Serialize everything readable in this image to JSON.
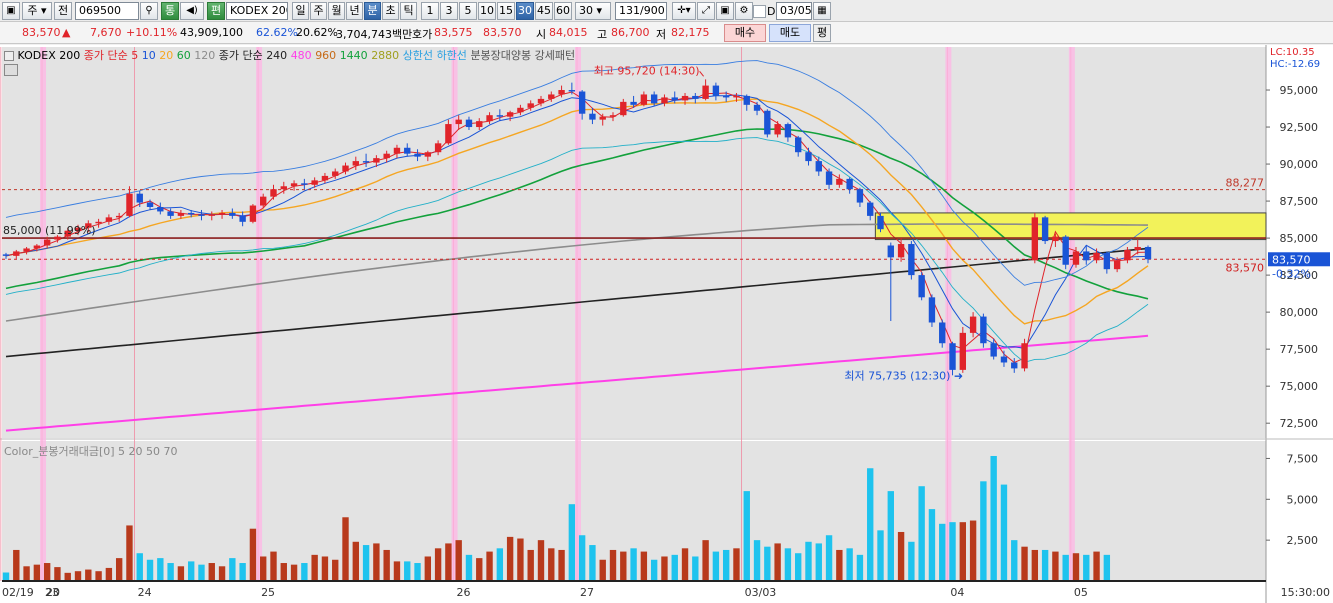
{
  "toolbar": {
    "period_type": "주",
    "prev_label": "전",
    "code": "069500",
    "stock_tab": "통",
    "edit_label": "편",
    "name": "KODEX 200",
    "periods": [
      "일",
      "주",
      "월",
      "년",
      "분",
      "초",
      "틱"
    ],
    "active_period": "분",
    "intervals": [
      "1",
      "3",
      "5",
      "10",
      "15",
      "30",
      "45",
      "60"
    ],
    "active_interval": "30",
    "interval_value": "30",
    "count_display": "131/900",
    "d_label": "D",
    "date": "03/05"
  },
  "quote": {
    "price": "83,570",
    "arrow": "▲",
    "change": "7,670",
    "change_pct": "+10.11%",
    "volume": "43,909,100",
    "ratio1": "62.62%",
    "ratio2": "20.62%",
    "amount": "3,704,743백만",
    "ask_label": "호가",
    "ask": "83,575",
    "bid": "83,570",
    "open_label": "시",
    "open": "84,015",
    "high_label": "고",
    "high": "86,700",
    "low_label": "저",
    "low": "82,175",
    "buy_label": "매수",
    "sell_label": "매도",
    "eval_label": "평"
  },
  "legend": {
    "name": "KODEX 200",
    "ma_label": "종가 단순",
    "ma1": "5",
    "ma2": "10",
    "ma3": "20",
    "ma4": "60",
    "ma5": "120",
    "ma_label2": "종가 단순",
    "ma6": "240",
    "ma7": "480",
    "ma8": "960",
    "ma9": "1440",
    "ma10": "2880",
    "upper": "상한선",
    "lower": "하한선",
    "pattern": "분봉장대양봉 강세패턴",
    "lc": "LC:10.35",
    "hc": "HC:-12.69"
  },
  "volume_legend": {
    "title": "Color_분봉거래대금[0]",
    "p1": "5",
    "p2": "20",
    "p3": "50",
    "p4": "70"
  },
  "annotations": {
    "high": "최고 95,720 (14:30)",
    "low": "최저 75,735 (12:30)",
    "level_85000": "85,000 (11.99%)",
    "line_88277": "88,277",
    "line_83570": "83,570",
    "price_tag": "83,570",
    "price_pct": "-0.32%"
  },
  "price_axis": [
    "95,000",
    "92,500",
    "90,000",
    "87,500",
    "85,000",
    "82,500",
    "80,000",
    "77,500",
    "75,000",
    "72,500"
  ],
  "volume_axis": [
    "7,500",
    "5,000",
    "2,500"
  ],
  "date_labels": [
    "02/19",
    "20",
    "23",
    "24",
    "25",
    "26",
    "27",
    "03/03",
    "04",
    "05"
  ],
  "time_label": "15:30:00",
  "colors": {
    "up": "#e0242a",
    "down": "#1a54d6",
    "ma5": "#e0242a",
    "ma10": "#1a54d6",
    "ma20": "#f5a623",
    "ma60": "#13a13c",
    "ma120": "#8c8c8c",
    "ma240": "#222222",
    "ma480": "#ff40e8",
    "vol_up": "#b83a1c",
    "vol_down": "#1ec3ee",
    "zone": "#f2f25a"
  },
  "chart_data": {
    "type": "candlestick",
    "price_range": [
      71500,
      97500
    ],
    "candles": [
      [
        83900,
        84000,
        83600,
        83800
      ],
      [
        83800,
        84200,
        83600,
        84100
      ],
      [
        84100,
        84400,
        83900,
        84300
      ],
      [
        84300,
        84600,
        84100,
        84500
      ],
      [
        84500,
        85100,
        84300,
        84900
      ],
      [
        84900,
        85200,
        84700,
        85100
      ],
      [
        85100,
        85700,
        84900,
        85500
      ],
      [
        85500,
        85900,
        85200,
        85700
      ],
      [
        85700,
        86200,
        85400,
        86000
      ],
      [
        86000,
        86300,
        85700,
        86100
      ],
      [
        86100,
        86600,
        85900,
        86400
      ],
      [
        86400,
        86700,
        86100,
        86500
      ],
      [
        86500,
        88500,
        86400,
        88000
      ],
      [
        88000,
        88200,
        87100,
        87400
      ],
      [
        87400,
        87600,
        86900,
        87100
      ],
      [
        87100,
        87400,
        86600,
        86800
      ],
      [
        86800,
        87000,
        86300,
        86500
      ],
      [
        86500,
        86900,
        86300,
        86700
      ],
      [
        86700,
        86900,
        86400,
        86600
      ],
      [
        86600,
        86900,
        86200,
        86500
      ],
      [
        86500,
        86800,
        86200,
        86600
      ],
      [
        86600,
        86900,
        86300,
        86700
      ],
      [
        86700,
        87000,
        86300,
        86500
      ],
      [
        86500,
        86800,
        85800,
        86100
      ],
      [
        86100,
        87300,
        86000,
        87200
      ],
      [
        87200,
        88000,
        87000,
        87800
      ],
      [
        87800,
        88600,
        87600,
        88300
      ],
      [
        88300,
        88800,
        88000,
        88500
      ],
      [
        88500,
        88900,
        88200,
        88700
      ],
      [
        88700,
        89000,
        88300,
        88600
      ],
      [
        88600,
        89100,
        88400,
        88900
      ],
      [
        88900,
        89400,
        88700,
        89200
      ],
      [
        89200,
        89700,
        89000,
        89500
      ],
      [
        89500,
        90100,
        89300,
        89900
      ],
      [
        89900,
        90500,
        89600,
        90200
      ],
      [
        90200,
        90700,
        89800,
        90100
      ],
      [
        90100,
        90600,
        89800,
        90400
      ],
      [
        90400,
        90900,
        90100,
        90700
      ],
      [
        90700,
        91300,
        90400,
        91100
      ],
      [
        91100,
        91400,
        90500,
        90700
      ],
      [
        90700,
        91000,
        90200,
        90500
      ],
      [
        90500,
        90900,
        90200,
        90800
      ],
      [
        90800,
        91600,
        90600,
        91400
      ],
      [
        91400,
        93000,
        91300,
        92700
      ],
      [
        92700,
        93300,
        92300,
        93000
      ],
      [
        93000,
        93200,
        92300,
        92500
      ],
      [
        92500,
        93100,
        92300,
        92900
      ],
      [
        92900,
        93500,
        92700,
        93300
      ],
      [
        93300,
        93700,
        92900,
        93200
      ],
      [
        93200,
        93600,
        92900,
        93500
      ],
      [
        93500,
        94000,
        93300,
        93800
      ],
      [
        93800,
        94300,
        93600,
        94100
      ],
      [
        94100,
        94600,
        93900,
        94400
      ],
      [
        94400,
        94900,
        94200,
        94700
      ],
      [
        94700,
        95300,
        94500,
        95000
      ],
      [
        95000,
        95500,
        94700,
        94900
      ],
      [
        94900,
        95000,
        93000,
        93400
      ],
      [
        93400,
        93800,
        92700,
        93000
      ],
      [
        93000,
        93400,
        92600,
        93200
      ],
      [
        93200,
        93500,
        92900,
        93300
      ],
      [
        93300,
        94400,
        93200,
        94200
      ],
      [
        94200,
        94600,
        93800,
        94000
      ],
      [
        94000,
        94900,
        93900,
        94700
      ],
      [
        94700,
        94900,
        93900,
        94100
      ],
      [
        94100,
        94700,
        93900,
        94500
      ],
      [
        94500,
        94900,
        94100,
        94300
      ],
      [
        94300,
        94800,
        94000,
        94600
      ],
      [
        94600,
        94800,
        94100,
        94400
      ],
      [
        94400,
        95720,
        94300,
        95300
      ],
      [
        95300,
        95500,
        94300,
        94600
      ],
      [
        94600,
        94900,
        94200,
        94500
      ],
      [
        94500,
        94800,
        94200,
        94600
      ],
      [
        94600,
        94700,
        93600,
        94000
      ],
      [
        94000,
        94200,
        93300,
        93600
      ],
      [
        93600,
        93700,
        91800,
        92000
      ],
      [
        92000,
        92900,
        91800,
        92700
      ],
      [
        92700,
        92800,
        91500,
        91800
      ],
      [
        91800,
        91900,
        90500,
        90800
      ],
      [
        90800,
        91100,
        89900,
        90200
      ],
      [
        90200,
        90500,
        89200,
        89500
      ],
      [
        89500,
        89700,
        88300,
        88600
      ],
      [
        88600,
        89300,
        88400,
        89000
      ],
      [
        89000,
        89100,
        88000,
        88300
      ],
      [
        88300,
        88400,
        87100,
        87400
      ],
      [
        87400,
        87500,
        86200,
        86500
      ],
      [
        86500,
        86700,
        85400,
        85600
      ],
      [
        84500,
        84700,
        79400,
        83700
      ],
      [
        83700,
        85000,
        83400,
        84600
      ],
      [
        84600,
        84800,
        82200,
        82500
      ],
      [
        82500,
        82700,
        80800,
        81000
      ],
      [
        81000,
        81200,
        79000,
        79300
      ],
      [
        79300,
        79500,
        77600,
        77900
      ],
      [
        77900,
        78000,
        75735,
        76100
      ],
      [
        76100,
        79000,
        75900,
        78600
      ],
      [
        78600,
        80000,
        78300,
        79700
      ],
      [
        79700,
        79900,
        77600,
        77900
      ],
      [
        77900,
        78200,
        76800,
        77000
      ],
      [
        77000,
        77400,
        76300,
        76600
      ],
      [
        76600,
        76900,
        75900,
        76200
      ],
      [
        76200,
        78200,
        76000,
        77900
      ],
      [
        83500,
        86700,
        83300,
        86400
      ],
      [
        86400,
        86500,
        84600,
        84800
      ],
      [
        84800,
        85300,
        84400,
        85100
      ],
      [
        85100,
        85200,
        82900,
        83200
      ],
      [
        83200,
        84400,
        83000,
        84100
      ],
      [
        84100,
        84500,
        83200,
        83500
      ],
      [
        83500,
        84300,
        83300,
        84000
      ],
      [
        84000,
        84100,
        82600,
        82900
      ],
      [
        82900,
        83700,
        82700,
        83500
      ],
      [
        83500,
        84400,
        83300,
        84200
      ],
      [
        84200,
        84900,
        83900,
        84400
      ],
      [
        84400,
        84500,
        83300,
        83570
      ]
    ],
    "volume": [
      520,
      1900,
      900,
      1000,
      1100,
      850,
      500,
      600,
      700,
      600,
      800,
      1400,
      3400,
      1700,
      1300,
      1400,
      1100,
      900,
      1200,
      1000,
      1100,
      900,
      1400,
      1100,
      3200,
      1500,
      1800,
      1100,
      1000,
      1100,
      1600,
      1500,
      1300,
      3900,
      2400,
      2200,
      2300,
      1900,
      1200,
      1200,
      1100,
      1500,
      2000,
      2300,
      2500,
      1600,
      1400,
      1800,
      2000,
      2700,
      2600,
      1900,
      2500,
      2000,
      1900,
      4700,
      2800,
      2200,
      1300,
      1900,
      1800,
      2000,
      1800,
      1300,
      1500,
      1600,
      2000,
      1500,
      2500,
      1800,
      1900,
      2000,
      5500,
      2500,
      2100,
      2300,
      2000,
      1700,
      2400,
      2300,
      2800,
      1900,
      2000,
      1600,
      6900,
      3100,
      5500,
      3000,
      2400,
      5800,
      4400,
      3500,
      3600,
      3600,
      3700,
      6100,
      7650,
      5900,
      2500,
      2100,
      1900,
      1900,
      1800,
      1600,
      1700,
      1600,
      1800,
      1600
    ],
    "reference_lines": [
      88277,
      85000,
      83570
    ],
    "zone": [
      84900,
      86700
    ]
  }
}
